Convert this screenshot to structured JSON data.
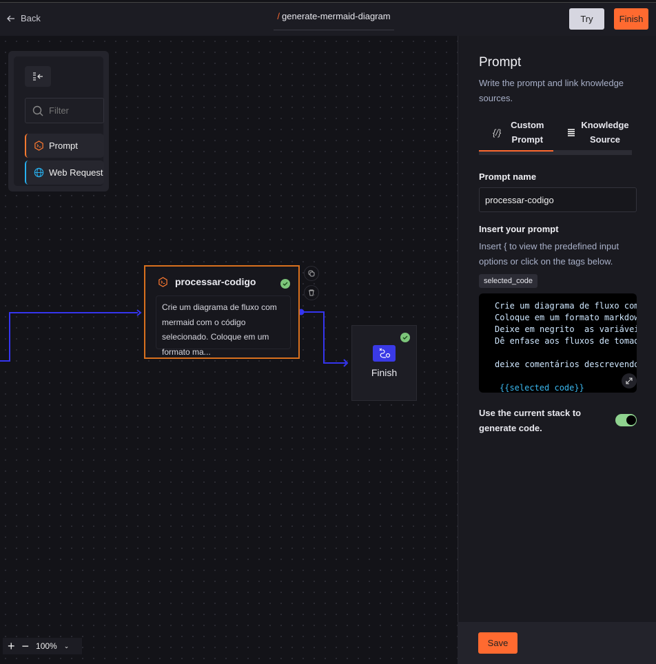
{
  "header": {
    "back_label": "Back",
    "title_prefix": "/",
    "title": "generate-mermaid-diagram",
    "try_label": "Try",
    "finish_label": "Finish"
  },
  "palette": {
    "filter_placeholder": "Filter",
    "items": [
      {
        "label": "Prompt",
        "icon": "prompt-hexagon-icon",
        "color": "#ff7a30"
      },
      {
        "label": "Web Request",
        "icon": "globe-icon",
        "color": "#27b0ef"
      }
    ]
  },
  "canvas": {
    "prompt_node": {
      "title": "processar-codigo",
      "body": "Crie um diagrama de fluxo com mermaid com o código selecionado. Coloque em um formato ma...",
      "status": "valid"
    },
    "finish_node": {
      "label": "Finish",
      "status": "valid"
    },
    "zoom": {
      "level": "100%"
    }
  },
  "panel": {
    "title": "Prompt",
    "description": "Write the prompt and link knowledge sources.",
    "tabs": [
      {
        "label": "Custom Prompt",
        "active": true
      },
      {
        "label": "Knowledge Source",
        "active": false
      }
    ],
    "prompt_name_label": "Prompt name",
    "prompt_name_value": "processar-codigo",
    "insert_label": "Insert your prompt",
    "insert_hint": "Insert { to view the predefined input options or click on the tags below.",
    "tag": "selected_code",
    "code_lines": [
      "Crie um diagrama de fluxo com",
      "Coloque em um formato markdown",
      "Deixe em negrito  as variáveis",
      "Dê enfase aos fluxos de tomada",
      "",
      "deixe comentários descrevendo",
      "",
      "{{selected code}}"
    ],
    "toggle_label": "Use the current stack to generate code.",
    "toggle_on": true,
    "save_label": "Save"
  },
  "colors": {
    "accent": "#ff6a30",
    "edge": "#3535f0",
    "success": "#7cc57a"
  }
}
